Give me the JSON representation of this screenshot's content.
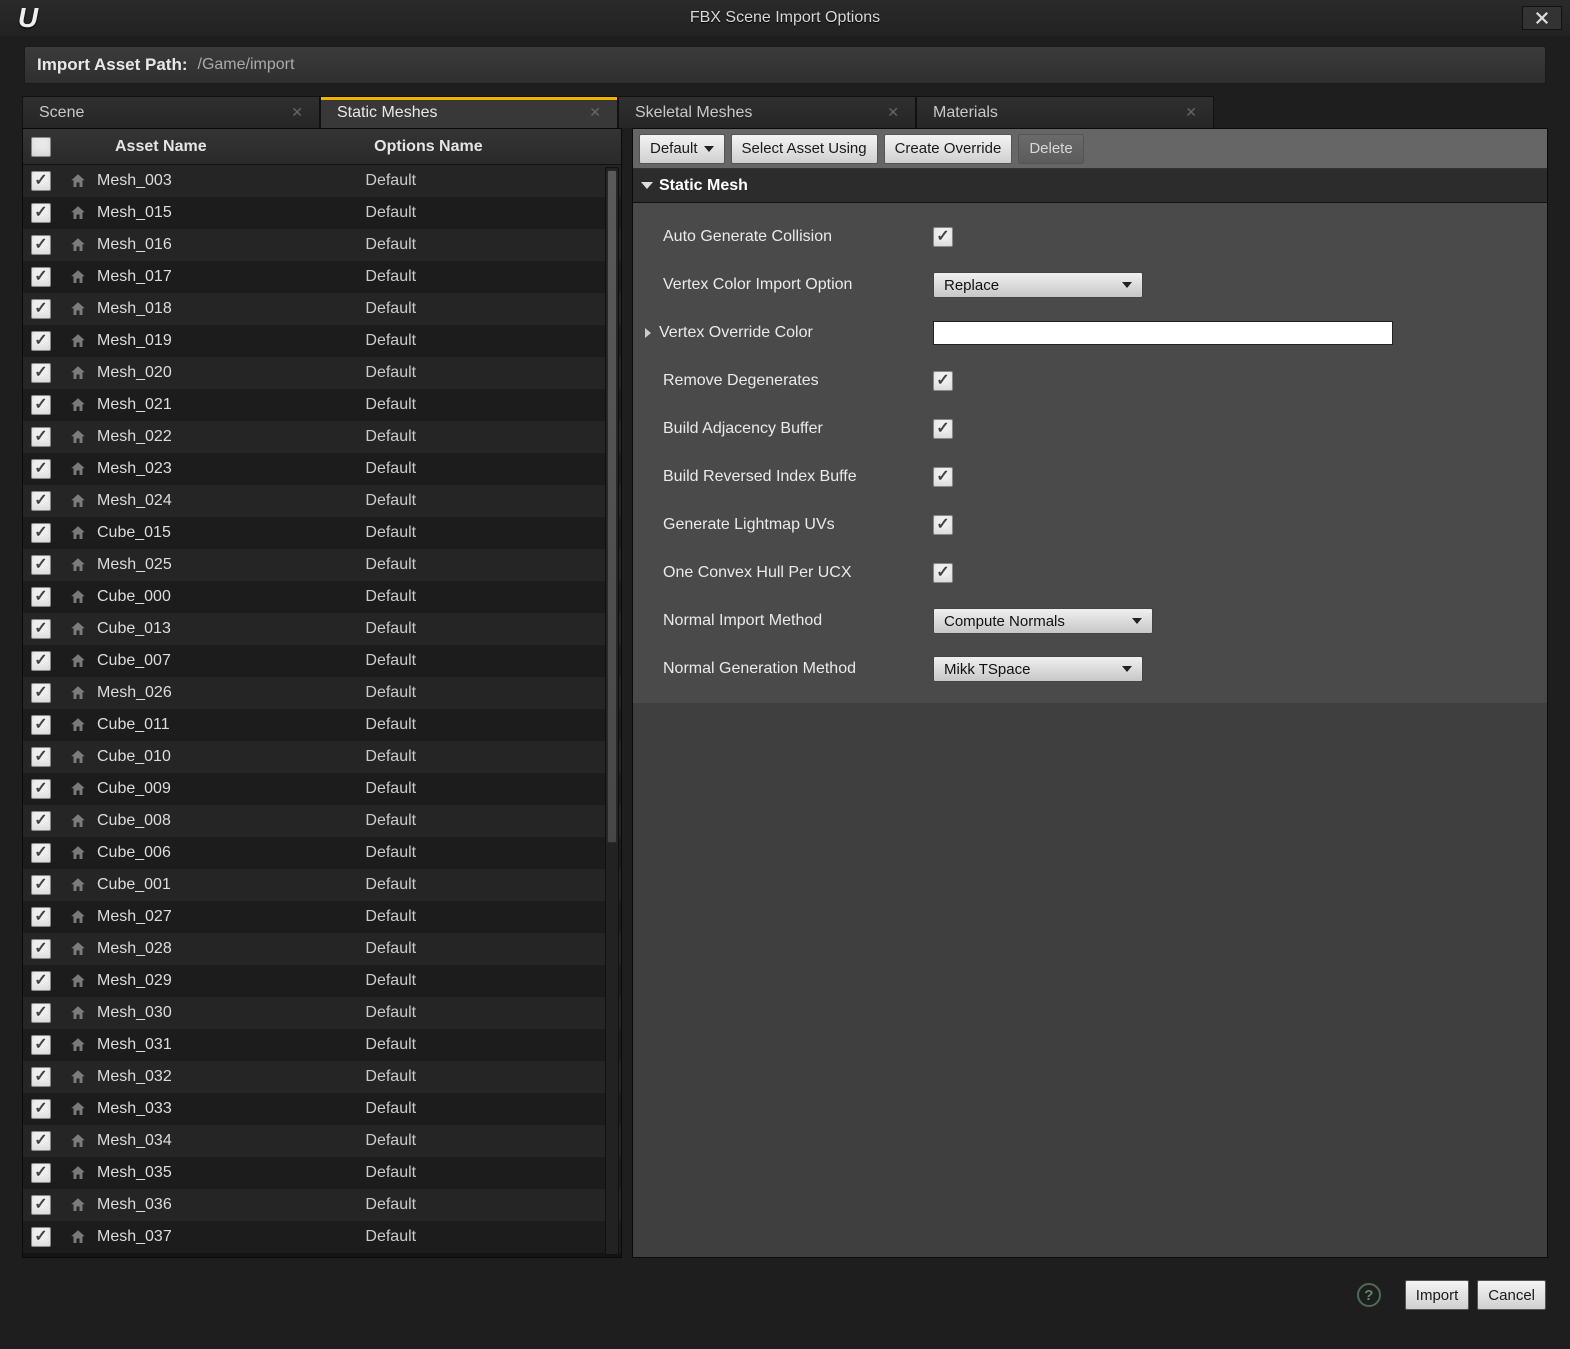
{
  "window": {
    "title": "FBX Scene Import Options"
  },
  "path": {
    "label": "Import Asset Path:",
    "value": "/Game/import"
  },
  "tabs": [
    {
      "label": "Scene",
      "active": false
    },
    {
      "label": "Static Meshes",
      "active": true
    },
    {
      "label": "Skeletal Meshes",
      "active": false
    },
    {
      "label": "Materials",
      "active": false
    }
  ],
  "columns": {
    "asset": "Asset Name",
    "options": "Options Name"
  },
  "assets": [
    {
      "name": "Mesh_003",
      "options": "Default",
      "checked": true
    },
    {
      "name": "Mesh_015",
      "options": "Default",
      "checked": true
    },
    {
      "name": "Mesh_016",
      "options": "Default",
      "checked": true
    },
    {
      "name": "Mesh_017",
      "options": "Default",
      "checked": true
    },
    {
      "name": "Mesh_018",
      "options": "Default",
      "checked": true
    },
    {
      "name": "Mesh_019",
      "options": "Default",
      "checked": true
    },
    {
      "name": "Mesh_020",
      "options": "Default",
      "checked": true
    },
    {
      "name": "Mesh_021",
      "options": "Default",
      "checked": true
    },
    {
      "name": "Mesh_022",
      "options": "Default",
      "checked": true
    },
    {
      "name": "Mesh_023",
      "options": "Default",
      "checked": true
    },
    {
      "name": "Mesh_024",
      "options": "Default",
      "checked": true
    },
    {
      "name": "Cube_015",
      "options": "Default",
      "checked": true
    },
    {
      "name": "Mesh_025",
      "options": "Default",
      "checked": true
    },
    {
      "name": "Cube_000",
      "options": "Default",
      "checked": true
    },
    {
      "name": "Cube_013",
      "options": "Default",
      "checked": true
    },
    {
      "name": "Cube_007",
      "options": "Default",
      "checked": true
    },
    {
      "name": "Mesh_026",
      "options": "Default",
      "checked": true
    },
    {
      "name": "Cube_011",
      "options": "Default",
      "checked": true
    },
    {
      "name": "Cube_010",
      "options": "Default",
      "checked": true
    },
    {
      "name": "Cube_009",
      "options": "Default",
      "checked": true
    },
    {
      "name": "Cube_008",
      "options": "Default",
      "checked": true
    },
    {
      "name": "Cube_006",
      "options": "Default",
      "checked": true
    },
    {
      "name": "Cube_001",
      "options": "Default",
      "checked": true
    },
    {
      "name": "Mesh_027",
      "options": "Default",
      "checked": true
    },
    {
      "name": "Mesh_028",
      "options": "Default",
      "checked": true
    },
    {
      "name": "Mesh_029",
      "options": "Default",
      "checked": true
    },
    {
      "name": "Mesh_030",
      "options": "Default",
      "checked": true
    },
    {
      "name": "Mesh_031",
      "options": "Default",
      "checked": true
    },
    {
      "name": "Mesh_032",
      "options": "Default",
      "checked": true
    },
    {
      "name": "Mesh_033",
      "options": "Default",
      "checked": true
    },
    {
      "name": "Mesh_034",
      "options": "Default",
      "checked": true
    },
    {
      "name": "Mesh_035",
      "options": "Default",
      "checked": true
    },
    {
      "name": "Mesh_036",
      "options": "Default",
      "checked": true
    },
    {
      "name": "Mesh_037",
      "options": "Default",
      "checked": true
    }
  ],
  "toolbar": {
    "default": "Default",
    "select_asset": "Select Asset Using",
    "create_override": "Create Override",
    "delete": "Delete"
  },
  "section": {
    "title": "Static Mesh"
  },
  "props": {
    "auto_collision": {
      "label": "Auto Generate Collision",
      "checked": true
    },
    "vertex_color_opt": {
      "label": "Vertex Color Import Option",
      "value": "Replace"
    },
    "vertex_override": {
      "label": "Vertex Override Color",
      "color": "#ffffff"
    },
    "remove_degen": {
      "label": "Remove Degenerates",
      "checked": true
    },
    "adjacency": {
      "label": "Build Adjacency Buffer",
      "checked": true
    },
    "reversed_index": {
      "label": "Build Reversed Index Buffe",
      "checked": true
    },
    "lightmap": {
      "label": "Generate Lightmap UVs",
      "checked": true
    },
    "convex_hull": {
      "label": "One Convex Hull Per UCX",
      "checked": true
    },
    "normal_import": {
      "label": "Normal Import Method",
      "value": "Compute Normals"
    },
    "normal_gen": {
      "label": "Normal Generation Method",
      "value": "Mikk TSpace"
    }
  },
  "footer": {
    "import": "Import",
    "cancel": "Cancel"
  }
}
